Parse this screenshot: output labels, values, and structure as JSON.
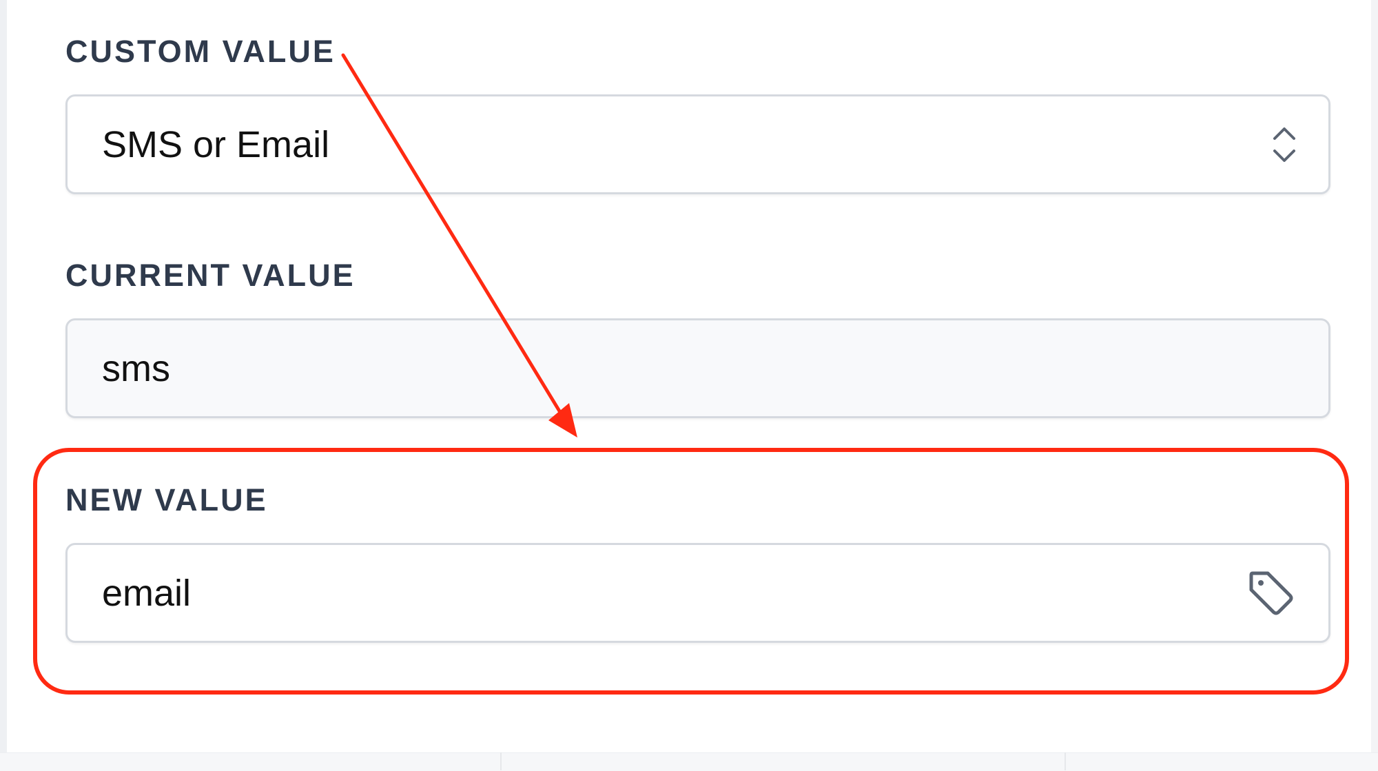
{
  "form": {
    "custom_value": {
      "label": "CUSTOM VALUE",
      "selected": "SMS or Email",
      "icon": "chevron-up-down-icon"
    },
    "current_value": {
      "label": "CURRENT VALUE",
      "value": "sms"
    },
    "new_value": {
      "label": "NEW VALUE",
      "value": "email",
      "icon": "tag-icon"
    }
  },
  "annotations": {
    "arrow_color": "#ff2a12",
    "highlight_color": "#ff2a12"
  }
}
